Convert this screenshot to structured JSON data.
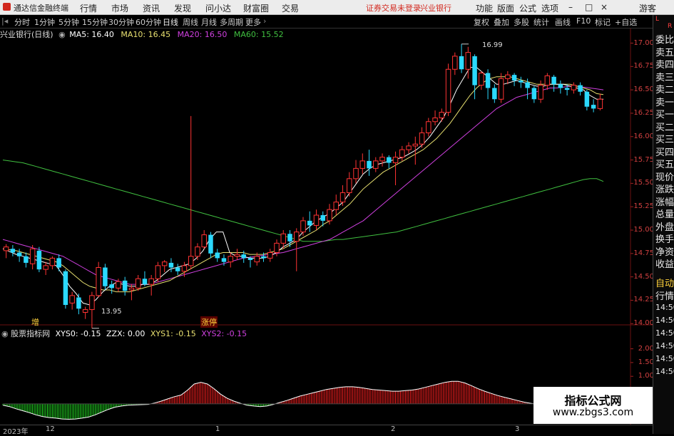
{
  "menubar": {
    "app_title": "通达信金融终端",
    "items": [
      "行情",
      "市场",
      "资讯",
      "发现",
      "问小达",
      "财富圈",
      "交易"
    ],
    "notice": "证券交易未登录",
    "stock_name": "兴业银行",
    "right_items": [
      "功能",
      "版面",
      "公式",
      "选项"
    ],
    "guest": "游客"
  },
  "periodbar": {
    "periods": [
      "分时",
      "1分钟",
      "5分钟",
      "15分钟",
      "30分钟",
      "60分钟",
      "日线",
      "周线",
      "月线",
      "多周期",
      "更多"
    ],
    "active_period": "日线",
    "tools": [
      "复权",
      "叠加",
      "多股",
      "统计",
      "画线",
      "F10",
      "标记",
      "+自选"
    ]
  },
  "info": {
    "title": "兴业银行(日线)",
    "ma5": "MA5: 16.40",
    "ma10": "MA10: 16.45",
    "ma20": "MA20: 16.50",
    "ma60": "MA60: 15.52"
  },
  "indicator_info": {
    "name": "股票指标网",
    "xys0": "XYS0: -0.15",
    "zzx": "ZZX: 0.00",
    "xys1": "XYS1: -0.15",
    "xys2": "XYS2: -0.15"
  },
  "right_panel": {
    "items": [
      "委比",
      "卖五",
      "卖四",
      "卖三",
      "卖二",
      "卖一",
      "买一",
      "买二",
      "买三",
      "买四",
      "买五",
      "现价",
      "涨跌",
      "涨幅",
      "总量",
      "外盘",
      "换手",
      "净资",
      "收益"
    ],
    "auto": "自动",
    "quote": "行情",
    "times": [
      "14:50",
      "14:50",
      "14:50",
      "14:50",
      "14:50",
      "14:50"
    ],
    "top_letters": [
      "L",
      "R",
      "L"
    ]
  },
  "price_axis": [
    "17.00",
    "16.75",
    "16.50",
    "16.25",
    "16.00",
    "15.75",
    "15.50",
    "15.25",
    "15.00",
    "14.75",
    "14.50",
    "14.25",
    "14.00"
  ],
  "indicator_axis": [
    "2.00",
    "1.50",
    "1.00"
  ],
  "time_axis": [
    "2023年",
    "12",
    "1",
    "2",
    "3"
  ],
  "annotations": {
    "high": "16.99",
    "low": "13.95",
    "event1": "增",
    "event2": "涨停"
  },
  "watermark": {
    "line1": "指标公式网",
    "line2": "www.zbgs3.com"
  },
  "colors": {
    "up": "#ff3333",
    "down": "#2bd9ff",
    "ma5": "#ffffff",
    "ma10": "#e8e070",
    "ma20": "#d040e0",
    "ma60": "#40c040",
    "hist_pos": "#ff2020",
    "hist_neg": "#22dd22"
  },
  "chart_data": {
    "type": "candlestick",
    "ylim": [
      13.88,
      17.08
    ],
    "candles": [
      [
        14.78,
        14.82,
        14.7,
        14.85
      ],
      [
        14.8,
        14.76,
        14.72,
        14.84
      ],
      [
        14.76,
        14.72,
        14.66,
        14.8
      ],
      [
        14.72,
        14.65,
        14.6,
        14.76
      ],
      [
        14.64,
        14.8,
        14.58,
        14.84
      ],
      [
        14.78,
        14.58,
        14.55,
        14.82
      ],
      [
        14.58,
        14.62,
        14.52,
        14.66
      ],
      [
        14.62,
        14.7,
        14.58,
        14.72
      ],
      [
        14.7,
        14.6,
        14.56,
        14.74
      ],
      [
        14.56,
        14.2,
        14.16,
        14.58
      ],
      [
        14.22,
        14.3,
        14.15,
        14.34
      ],
      [
        14.28,
        14.16,
        14.1,
        14.32
      ],
      [
        14.12,
        14.15,
        14.05,
        14.18
      ],
      [
        14.15,
        14.3,
        13.95,
        14.34
      ],
      [
        14.3,
        14.6,
        14.28,
        14.66
      ],
      [
        14.6,
        14.4,
        14.36,
        14.64
      ],
      [
        14.42,
        14.38,
        14.32,
        14.46
      ],
      [
        14.38,
        14.45,
        14.34,
        14.48
      ],
      [
        14.46,
        14.35,
        14.3,
        14.5
      ],
      [
        14.36,
        14.38,
        14.25,
        14.42
      ],
      [
        14.38,
        14.48,
        14.35,
        14.52
      ],
      [
        14.48,
        14.42,
        14.4,
        14.56
      ],
      [
        14.42,
        14.48,
        14.3,
        14.52
      ],
      [
        14.48,
        14.62,
        14.44,
        14.66
      ],
      [
        14.62,
        14.66,
        14.55,
        14.68
      ],
      [
        14.65,
        14.6,
        14.55,
        14.7
      ],
      [
        14.6,
        14.56,
        14.52,
        14.64
      ],
      [
        14.56,
        14.62,
        14.5,
        14.66
      ],
      [
        14.62,
        14.72,
        14.58,
        16.22
      ],
      [
        14.72,
        14.82,
        14.68,
        14.86
      ],
      [
        14.82,
        14.95,
        14.8,
        15.0
      ],
      [
        14.95,
        14.75,
        14.7,
        14.98
      ],
      [
        14.76,
        14.7,
        14.66,
        14.8
      ],
      [
        14.7,
        14.66,
        14.62,
        14.74
      ],
      [
        14.66,
        14.72,
        14.6,
        14.76
      ],
      [
        14.72,
        14.74,
        14.68,
        14.8
      ],
      [
        14.74,
        14.7,
        14.65,
        14.78
      ],
      [
        14.7,
        14.68,
        14.6,
        14.72
      ],
      [
        14.66,
        14.72,
        14.62,
        14.76
      ],
      [
        14.72,
        14.7,
        14.66,
        14.76
      ],
      [
        14.7,
        14.76,
        14.66,
        14.8
      ],
      [
        14.76,
        14.86,
        14.72,
        14.9
      ],
      [
        14.86,
        14.96,
        14.8,
        15.0
      ],
      [
        14.96,
        14.88,
        14.82,
        15.0
      ],
      [
        14.88,
        14.98,
        14.56,
        15.02
      ],
      [
        14.98,
        15.1,
        14.94,
        15.14
      ],
      [
        15.1,
        15.05,
        14.98,
        15.2
      ],
      [
        15.05,
        15.16,
        15.0,
        15.22
      ],
      [
        15.16,
        15.1,
        15.04,
        15.2
      ],
      [
        15.1,
        15.22,
        15.06,
        15.28
      ],
      [
        15.22,
        15.3,
        15.16,
        15.38
      ],
      [
        15.3,
        15.4,
        15.26,
        15.48
      ],
      [
        15.4,
        15.55,
        15.36,
        15.62
      ],
      [
        15.55,
        15.66,
        15.5,
        15.75
      ],
      [
        15.66,
        15.74,
        15.6,
        15.82
      ],
      [
        15.74,
        15.66,
        15.58,
        15.86
      ],
      [
        15.66,
        15.74,
        15.62,
        15.78
      ],
      [
        15.74,
        15.78,
        15.68,
        15.82
      ],
      [
        15.78,
        15.72,
        15.66,
        15.8
      ],
      [
        15.72,
        15.78,
        15.48,
        15.84
      ],
      [
        15.78,
        15.86,
        15.74,
        15.9
      ],
      [
        15.86,
        15.9,
        15.82,
        15.94
      ],
      [
        15.9,
        15.92,
        15.7,
        16.0
      ],
      [
        15.92,
        16.04,
        15.88,
        16.1
      ],
      [
        16.04,
        16.16,
        16.0,
        16.2
      ],
      [
        16.16,
        16.2,
        16.12,
        16.28
      ],
      [
        16.2,
        16.26,
        16.16,
        16.3
      ],
      [
        16.26,
        16.72,
        16.22,
        16.78
      ],
      [
        16.72,
        16.86,
        16.66,
        16.9
      ],
      [
        16.86,
        16.72,
        16.68,
        16.99
      ],
      [
        16.72,
        16.9,
        16.62,
        16.96
      ],
      [
        16.86,
        16.55,
        16.4,
        16.88
      ],
      [
        16.55,
        16.68,
        16.5,
        16.7
      ],
      [
        16.68,
        16.52,
        16.4,
        16.72
      ],
      [
        16.52,
        16.4,
        16.36,
        16.56
      ],
      [
        16.4,
        16.62,
        16.36,
        16.68
      ],
      [
        16.62,
        16.66,
        16.56,
        16.7
      ],
      [
        16.66,
        16.6,
        16.54,
        16.68
      ],
      [
        16.6,
        16.58,
        16.52,
        16.64
      ],
      [
        16.58,
        16.52,
        16.4,
        16.62
      ],
      [
        16.52,
        16.4,
        16.36,
        16.54
      ],
      [
        16.4,
        16.55,
        16.36,
        16.6
      ],
      [
        16.55,
        16.65,
        16.5,
        16.68
      ],
      [
        16.64,
        16.56,
        16.48,
        16.66
      ],
      [
        16.56,
        16.52,
        16.46,
        16.6
      ],
      [
        16.52,
        16.5,
        16.44,
        16.56
      ],
      [
        16.5,
        16.55,
        16.46,
        16.58
      ],
      [
        16.55,
        16.48,
        16.44,
        16.58
      ],
      [
        16.48,
        16.32,
        16.28,
        16.5
      ],
      [
        16.34,
        16.3,
        16.26,
        16.4
      ],
      [
        16.3,
        16.4,
        16.28,
        16.46
      ]
    ],
    "ma_lines": {
      "ma5": [
        14.8,
        14.77,
        14.74,
        14.72,
        14.7,
        14.68,
        14.66,
        14.64,
        14.62,
        14.52,
        14.4,
        14.32,
        14.22,
        14.2,
        14.26,
        14.34,
        14.4,
        14.44,
        14.42,
        14.4,
        14.4,
        14.42,
        14.42,
        14.46,
        14.52,
        14.58,
        14.6,
        14.62,
        14.64,
        14.7,
        14.78,
        14.9,
        14.98,
        14.98,
        14.76,
        14.72,
        14.72,
        14.7,
        14.7,
        14.7,
        14.72,
        14.76,
        14.82,
        14.86,
        14.9,
        14.98,
        15.04,
        15.1,
        15.14,
        15.18,
        15.24,
        15.3,
        15.4,
        15.5,
        15.6,
        15.66,
        15.7,
        15.72,
        15.74,
        15.76,
        15.78,
        15.82,
        15.86,
        15.92,
        16.0,
        16.1,
        16.2,
        16.34,
        16.5,
        16.62,
        16.74,
        16.74,
        16.68,
        16.62,
        16.56,
        16.56,
        16.58,
        16.6,
        16.58,
        16.56,
        16.54,
        16.54,
        16.56,
        16.56,
        16.56,
        16.54,
        16.52,
        16.5,
        16.44,
        16.4,
        16.4
      ],
      "ma10": [
        14.8,
        14.79,
        14.78,
        14.76,
        14.74,
        14.72,
        14.7,
        14.68,
        14.66,
        14.62,
        14.56,
        14.5,
        14.44,
        14.4,
        14.38,
        14.36,
        14.36,
        14.34,
        14.34,
        14.34,
        14.36,
        14.38,
        14.4,
        14.42,
        14.44,
        14.46,
        14.5,
        14.54,
        14.58,
        14.62,
        14.66,
        14.7,
        14.74,
        14.76,
        14.76,
        14.76,
        14.76,
        14.74,
        14.74,
        14.74,
        14.76,
        14.78,
        14.8,
        14.84,
        14.88,
        14.92,
        14.96,
        15.0,
        15.06,
        15.1,
        15.16,
        15.22,
        15.28,
        15.36,
        15.44,
        15.5,
        15.56,
        15.62,
        15.66,
        15.7,
        15.74,
        15.78,
        15.82,
        15.86,
        15.92,
        15.98,
        16.06,
        16.14,
        16.24,
        16.34,
        16.44,
        16.52,
        16.58,
        16.62,
        16.64,
        16.64,
        16.64,
        16.62,
        16.6,
        16.58,
        16.56,
        16.56,
        16.56,
        16.56,
        16.56,
        16.56,
        16.54,
        16.52,
        16.5,
        16.46,
        16.45
      ],
      "ma20": [
        14.9,
        14.88,
        14.86,
        14.84,
        14.82,
        14.8,
        14.78,
        14.76,
        14.74,
        14.72,
        14.68,
        14.64,
        14.6,
        14.56,
        14.52,
        14.5,
        14.48,
        14.46,
        14.44,
        14.42,
        14.42,
        14.42,
        14.42,
        14.44,
        14.46,
        14.48,
        14.5,
        14.52,
        14.54,
        14.56,
        14.58,
        14.6,
        14.62,
        14.64,
        14.66,
        14.68,
        14.7,
        14.71,
        14.72,
        14.73,
        14.74,
        14.75,
        14.76,
        14.78,
        14.8,
        14.82,
        14.84,
        14.86,
        14.88,
        14.9,
        14.94,
        14.98,
        15.02,
        15.06,
        15.1,
        15.16,
        15.22,
        15.28,
        15.34,
        15.4,
        15.46,
        15.52,
        15.58,
        15.64,
        15.7,
        15.76,
        15.82,
        15.88,
        15.94,
        16.0,
        16.06,
        16.12,
        16.18,
        16.24,
        16.3,
        16.34,
        16.38,
        16.42,
        16.44,
        16.46,
        16.48,
        16.5,
        16.52,
        16.52,
        16.53,
        16.54,
        16.54,
        16.53,
        16.52,
        16.51,
        16.5
      ],
      "ma60": [
        15.75,
        15.74,
        15.73,
        15.72,
        15.7,
        15.68,
        15.66,
        15.64,
        15.62,
        15.6,
        15.58,
        15.56,
        15.54,
        15.52,
        15.5,
        15.48,
        15.46,
        15.44,
        15.42,
        15.4,
        15.38,
        15.36,
        15.34,
        15.32,
        15.3,
        15.28,
        15.26,
        15.24,
        15.22,
        15.2,
        15.18,
        15.16,
        15.14,
        15.12,
        15.1,
        15.08,
        15.06,
        15.04,
        15.02,
        15.0,
        14.98,
        14.96,
        14.94,
        14.92,
        14.9,
        14.88,
        14.88,
        14.88,
        14.88,
        14.89,
        14.9,
        14.9,
        14.91,
        14.92,
        14.93,
        14.94,
        14.95,
        14.96,
        14.97,
        14.98,
        15.0,
        15.02,
        15.04,
        15.06,
        15.08,
        15.1,
        15.12,
        15.14,
        15.16,
        15.18,
        15.2,
        15.22,
        15.24,
        15.26,
        15.28,
        15.3,
        15.32,
        15.34,
        15.36,
        15.38,
        15.4,
        15.42,
        15.44,
        15.46,
        15.48,
        15.5,
        15.52,
        15.54,
        15.55,
        15.55,
        15.52
      ]
    },
    "indicator": {
      "ylim": [
        -0.6,
        2.3
      ],
      "histogram": [
        -0.05,
        -0.1,
        -0.18,
        -0.25,
        -0.32,
        -0.4,
        -0.46,
        -0.5,
        -0.52,
        -0.55,
        -0.56,
        -0.55,
        -0.52,
        -0.48,
        -0.4,
        -0.3,
        -0.2,
        -0.12,
        -0.08,
        -0.05,
        -0.04,
        -0.03,
        -0.02,
        0.03,
        0.1,
        0.18,
        0.26,
        0.32,
        0.5,
        0.72,
        0.78,
        0.72,
        0.55,
        0.35,
        0.2,
        0.1,
        0.02,
        -0.05,
        -0.08,
        -0.1,
        -0.08,
        -0.02,
        0.05,
        0.12,
        0.2,
        0.28,
        0.34,
        0.4,
        0.46,
        0.52,
        0.56,
        0.6,
        0.62,
        0.62,
        0.6,
        0.56,
        0.52,
        0.5,
        0.48,
        0.46,
        0.46,
        0.48,
        0.5,
        0.54,
        0.6,
        0.66,
        0.72,
        0.78,
        0.82,
        0.82,
        0.76,
        0.66,
        0.55,
        0.46,
        0.38,
        0.3,
        0.24,
        0.18,
        0.12,
        0.06,
        0.02,
        -0.02,
        -0.06,
        -0.09,
        -0.11,
        -0.12,
        -0.13,
        -0.14,
        -0.15,
        -0.15,
        -0.15
      ]
    }
  }
}
